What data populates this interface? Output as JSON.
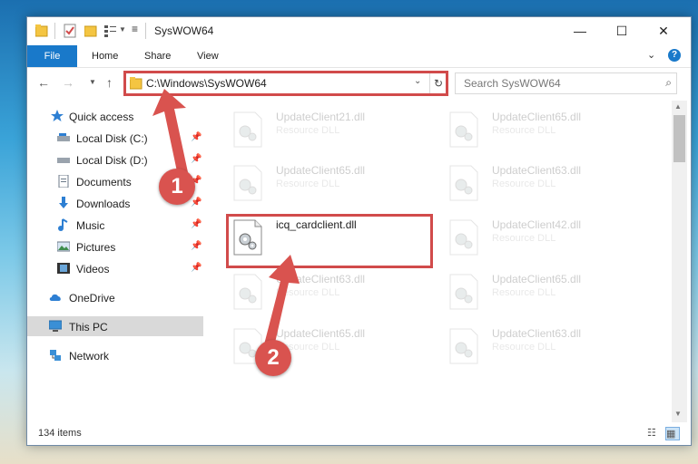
{
  "window": {
    "title": "SysWOW64",
    "controls": {
      "minimize": "—",
      "maximize": "☐",
      "close": "✕"
    }
  },
  "ribbon": {
    "file_tab": "File",
    "tabs": [
      "Home",
      "Share",
      "View"
    ],
    "help_label": "?"
  },
  "navigation": {
    "address": "C:\\Windows\\SysWOW64",
    "search_placeholder": "Search SysWOW64"
  },
  "sidebar": {
    "items": [
      {
        "label": "Quick access",
        "icon": "star-icon",
        "pinned": false
      },
      {
        "label": "Local Disk (C:)",
        "icon": "drive-icon",
        "pinned": true
      },
      {
        "label": "Local Disk (D:)",
        "icon": "drive-icon",
        "pinned": true
      },
      {
        "label": "Documents",
        "icon": "documents-icon",
        "pinned": true
      },
      {
        "label": "Downloads",
        "icon": "download-icon",
        "pinned": true
      },
      {
        "label": "Music",
        "icon": "music-icon",
        "pinned": true
      },
      {
        "label": "Pictures",
        "icon": "pictures-icon",
        "pinned": true
      },
      {
        "label": "Videos",
        "icon": "videos-icon",
        "pinned": true
      },
      {
        "label": "OneDrive",
        "icon": "cloud-icon",
        "pinned": false
      },
      {
        "label": "This PC",
        "icon": "pc-icon",
        "pinned": false,
        "selected": true
      },
      {
        "label": "Network",
        "icon": "network-icon",
        "pinned": false
      }
    ]
  },
  "files": [
    {
      "name": "UpdateClient21.dll",
      "type": "Resource DLL",
      "faded": true
    },
    {
      "name": "UpdateClient65.dll",
      "type": "Resource DLL",
      "faded": true
    },
    {
      "name": "UpdateClient65.dll",
      "type": "Resource DLL",
      "faded": true
    },
    {
      "name": "UpdateClient63.dll",
      "type": "Resource DLL",
      "faded": true
    },
    {
      "name": "icq_cardclient.dll",
      "type": "",
      "faded": false
    },
    {
      "name": "UpdateClient42.dll",
      "type": "Resource DLL",
      "faded": true
    },
    {
      "name": "UpdateClient63.dll",
      "type": "Resource DLL",
      "faded": true
    },
    {
      "name": "UpdateClient65.dll",
      "type": "Resource DLL",
      "faded": true
    },
    {
      "name": "UpdateClient65.dll",
      "type": "Resource DLL",
      "faded": true
    },
    {
      "name": "UpdateClient63.dll",
      "type": "Resource DLL",
      "faded": true
    }
  ],
  "status": {
    "item_count": "134 items"
  },
  "annotations": {
    "step1": "1",
    "step2": "2",
    "color": "#d14b4b"
  },
  "colors": {
    "accent": "#1979ca",
    "highlight": "#d14b4b"
  }
}
